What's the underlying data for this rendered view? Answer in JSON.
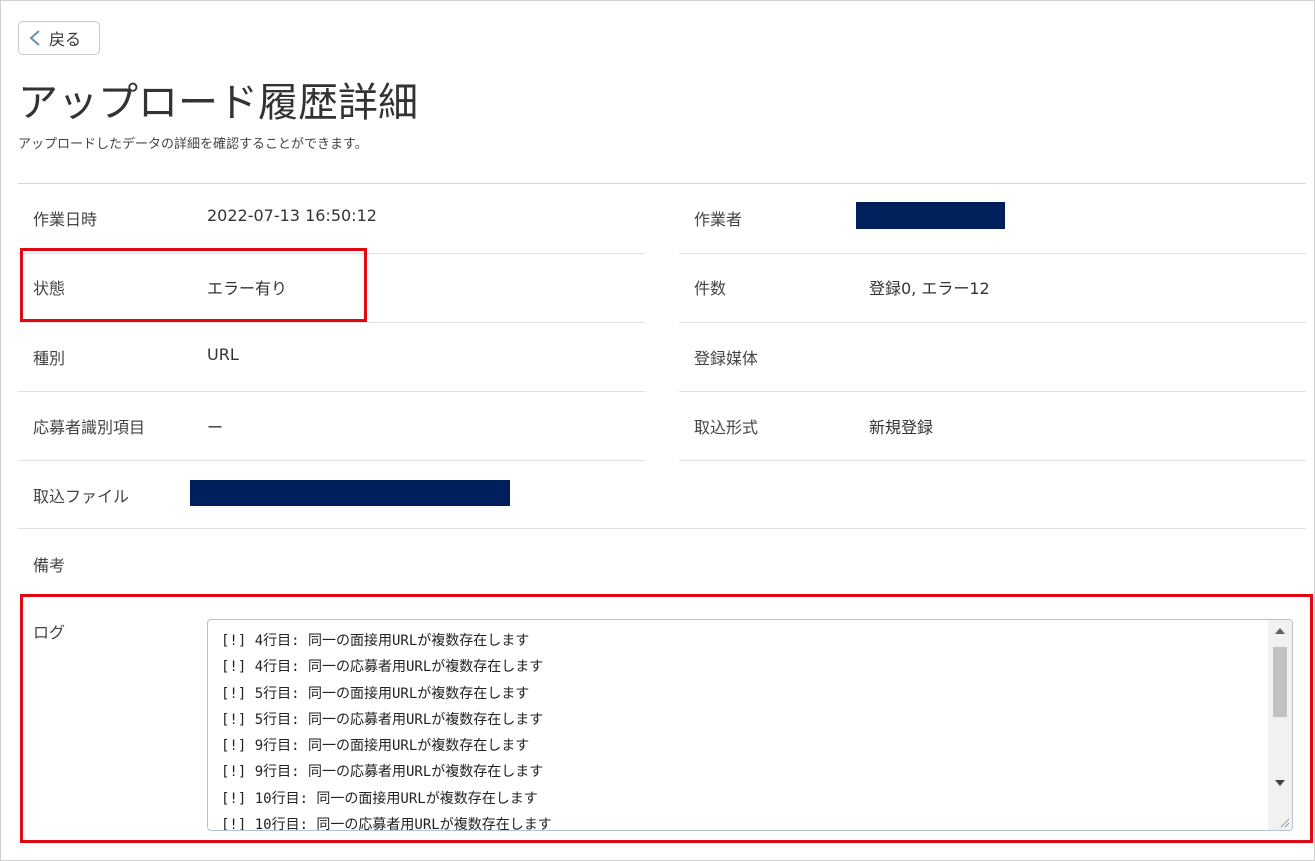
{
  "back_button": {
    "label": "戻る"
  },
  "page": {
    "title": "アップロード履歴詳細",
    "description": "アップロードしたデータの詳細を確認することができます。"
  },
  "fields": {
    "work_datetime": {
      "label": "作業日時",
      "value": "2022-07-13 16:50:12"
    },
    "worker": {
      "label": "作業者",
      "value": ""
    },
    "status": {
      "label": "状態",
      "value": "エラー有り"
    },
    "count": {
      "label": "件数",
      "value": "登録0, エラー12"
    },
    "type": {
      "label": "種別",
      "value": "URL"
    },
    "media": {
      "label": "登録媒体",
      "value": ""
    },
    "applicant_id_item": {
      "label": "応募者識別項目",
      "value": "ー"
    },
    "import_format": {
      "label": "取込形式",
      "value": "新規登録"
    },
    "import_file": {
      "label": "取込ファイル",
      "value": ""
    },
    "remarks": {
      "label": "備考",
      "value": ""
    },
    "log": {
      "label": "ログ"
    }
  },
  "log_lines": [
    "[!] 4行目: 同一の面接用URLが複数存在します",
    "[!] 4行目: 同一の応募者用URLが複数存在します",
    "[!] 5行目: 同一の面接用URLが複数存在します",
    "[!] 5行目: 同一の応募者用URLが複数存在します",
    "[!] 9行目: 同一の面接用URLが複数存在します",
    "[!] 9行目: 同一の応募者用URLが複数存在します",
    "[!] 10行目: 同一の面接用URLが複数存在します",
    "[!] 10行目: 同一の応募者用URLが複数存在します"
  ],
  "colors": {
    "highlight": "#e30613",
    "redaction": "#00205b"
  }
}
